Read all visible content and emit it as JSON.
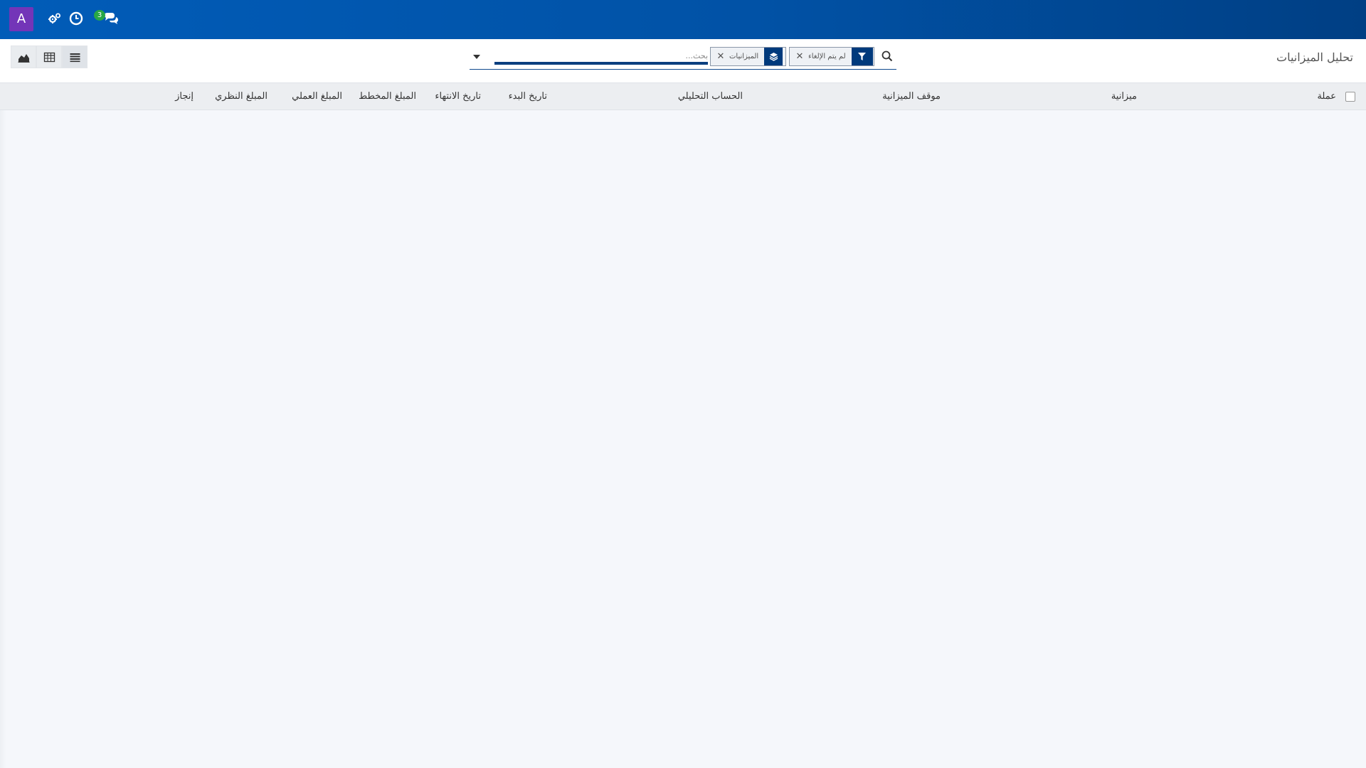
{
  "navbar": {
    "user_initial": "A",
    "icons": [
      "cogs-icon",
      "clock-icon",
      "chat-icon"
    ],
    "messages_badge": "3",
    "colors": {
      "navbar": "#0152a6",
      "avatar": "#7335b8",
      "badge": "#28a745"
    }
  },
  "page": {
    "title": "تحليل الميزانيات"
  },
  "search": {
    "placeholder": "بحث...",
    "facets": [
      {
        "icon": "filter-icon",
        "label": "لم يتم الإلغاء"
      },
      {
        "icon": "layers-icon",
        "label": "الميزانيات"
      }
    ]
  },
  "view_switcher": {
    "views": [
      "graph-view",
      "pivot-view",
      "list-view"
    ],
    "active": "list-view"
  },
  "table": {
    "columns": [
      "عملة",
      "ميزانية",
      "موقف الميزانية",
      "الحساب التحليلي",
      "تاريخ البدء",
      "تاريخ الانتهاء",
      "المبلغ المخطط",
      "المبلغ العملي",
      "المبلغ النظري",
      "إنجاز"
    ],
    "rows": []
  }
}
